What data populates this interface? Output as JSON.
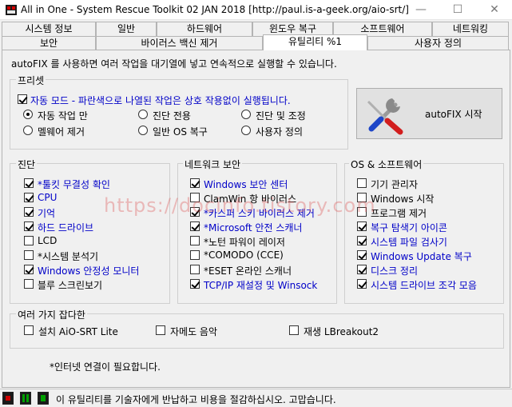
{
  "window": {
    "title": "All in One - System Rescue Toolkit 02 JAN 2018 [http://paul.is-a-geek.org/aio-srt/]",
    "min_glyph": "—",
    "max_glyph": "☐",
    "close_glyph": "✕"
  },
  "tabs_row1": [
    "시스템 정보",
    "일반",
    "하드웨어",
    "윈도우 복구",
    "소프트웨어",
    "네트워킹"
  ],
  "tabs_row2": [
    "보안",
    "바이러스 백신 제거",
    "유틸리티 %1",
    "사용자 정의"
  ],
  "active_tab": "유틸리티 %1",
  "intro": "autoFIX 를 사용하면 여러 작업을 대기열에 넣고 연속적으로 실행할 수 있습니다.",
  "presets": {
    "legend": "프리셋",
    "auto_mode": {
      "label": "자동 모드 - 파란색으로 나열된 작업은 상호 작용없이 실행됩니다.",
      "checked": true
    },
    "radios": [
      {
        "label": "자동 작업 만",
        "checked": true
      },
      {
        "label": "진단 전용",
        "checked": false
      },
      {
        "label": "진단 및 조정",
        "checked": false
      },
      {
        "label": "멜웨어 제거",
        "checked": false
      },
      {
        "label": "일반 OS 복구",
        "checked": false
      },
      {
        "label": "사용자 정의",
        "checked": false
      }
    ]
  },
  "autofix_button": {
    "label": "autoFIX 시작",
    "icon": "tools-icon"
  },
  "diagnostics": {
    "legend": "진단",
    "items": [
      {
        "label": "*툴킷 무결성 확인",
        "checked": true,
        "blue": true
      },
      {
        "label": "CPU",
        "checked": true,
        "blue": true
      },
      {
        "label": "기억",
        "checked": true,
        "blue": true
      },
      {
        "label": "하드 드라이브",
        "checked": true,
        "blue": true
      },
      {
        "label": "LCD",
        "checked": false,
        "blue": false
      },
      {
        "label": "*시스템 분석기",
        "checked": false,
        "blue": false
      },
      {
        "label": "Windows 안정성 모니터",
        "checked": true,
        "blue": true
      },
      {
        "label": "블루 스크린보기",
        "checked": false,
        "blue": false
      }
    ]
  },
  "network_security": {
    "legend": "네트워크 보안",
    "items": [
      {
        "label": "Windows 보안 센터",
        "checked": true,
        "blue": true
      },
      {
        "label": "ClamWin 항 바이러스",
        "checked": false,
        "blue": false
      },
      {
        "label": "*카스퍼 스키 바이러스 제거",
        "checked": true,
        "blue": true
      },
      {
        "label": "*Microsoft 안전 스캐너",
        "checked": true,
        "blue": true
      },
      {
        "label": "*노턴 파워이 레이저",
        "checked": false,
        "blue": false
      },
      {
        "label": "*COMODO (CCE)",
        "checked": false,
        "blue": false
      },
      {
        "label": "*ESET 온라인 스캐너",
        "checked": false,
        "blue": false
      },
      {
        "label": "TCP/IP 재설정 및 Winsock",
        "checked": true,
        "blue": true
      }
    ]
  },
  "os_software": {
    "legend": "OS & 소프트웨어",
    "items": [
      {
        "label": "기기 관리자",
        "checked": false,
        "blue": false
      },
      {
        "label": "Windows 시작",
        "checked": false,
        "blue": false
      },
      {
        "label": "프로그램 제거",
        "checked": false,
        "blue": false
      },
      {
        "label": "복구 탐색기 아이콘",
        "checked": true,
        "blue": true
      },
      {
        "label": "시스템 파일 검사기",
        "checked": true,
        "blue": true
      },
      {
        "label": "Windows Update 복구",
        "checked": true,
        "blue": true
      },
      {
        "label": "디스크 정리",
        "checked": true,
        "blue": true
      },
      {
        "label": "시스템 드라이브 조각 모음",
        "checked": true,
        "blue": true
      }
    ]
  },
  "misc": {
    "legend": "여러 가지 잡다한",
    "items": [
      {
        "label": "설치 AiO-SRT Lite",
        "checked": false
      },
      {
        "label": "자메도 음악",
        "checked": false
      },
      {
        "label": "재생 LBreakout2",
        "checked": false
      }
    ]
  },
  "internet_note": "*인터넷 연결이 필요합니다.",
  "watermark": "https://docinfo.tistory.com",
  "status": {
    "text": "이 유틸리티를 기술자에게 반납하고 비용을 절감하십시오. 고맙습니다.",
    "icons": [
      "stop-icon",
      "monitor-icon",
      "sound-icon"
    ]
  },
  "colors": {
    "blue_text": "#0000c8",
    "stop_red": "#cc0000",
    "indicator_green": "#00a000"
  }
}
